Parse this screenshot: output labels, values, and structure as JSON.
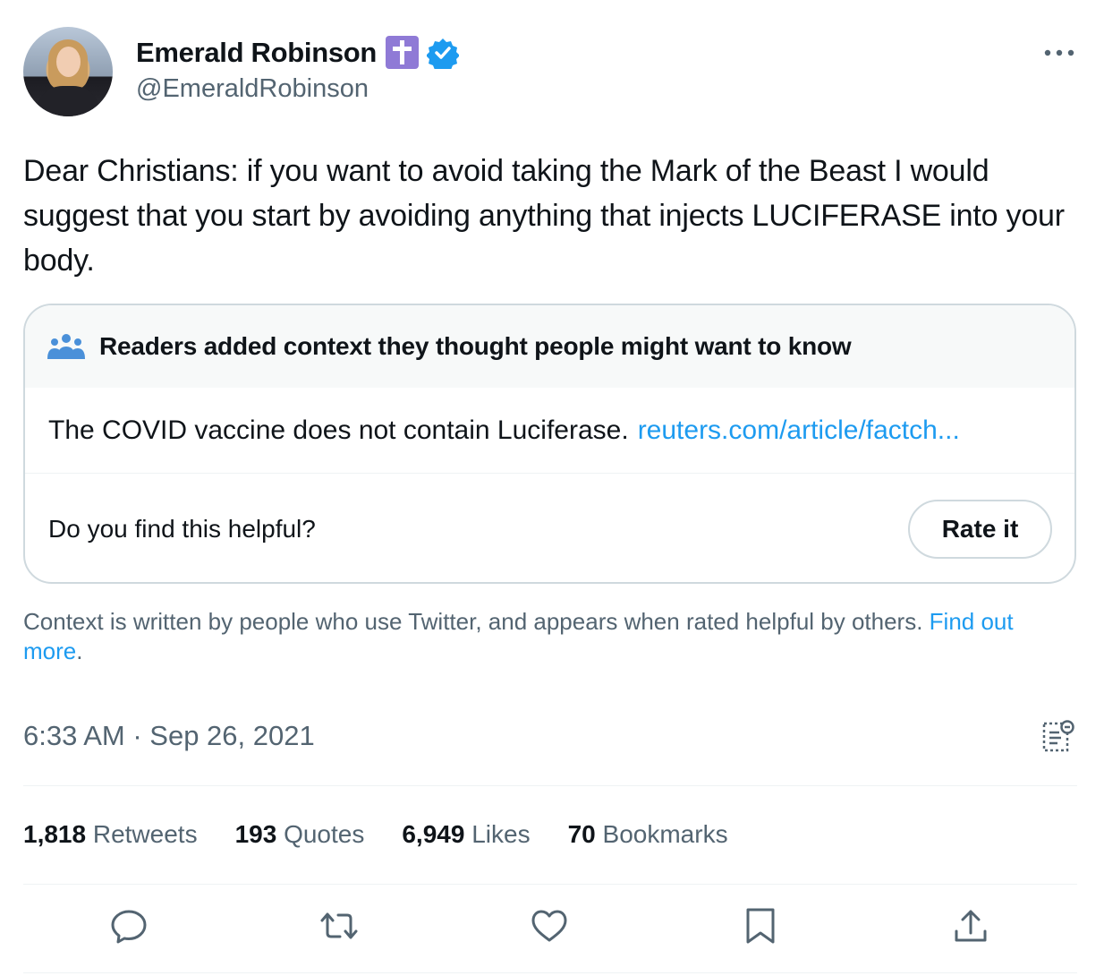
{
  "author": {
    "name": "Emerald Robinson",
    "handle": "@EmeraldRobinson",
    "badge_color": "#8f7ad6",
    "verified_color": "#1d9bf0"
  },
  "tweet": {
    "text": "Dear Christians: if you want to avoid taking the Mark of the Beast I would suggest that you start by avoiding anything that injects LUCIFERASE into your body."
  },
  "note": {
    "heading": "Readers added context they thought people might want to know",
    "body": "The COVID vaccine does not contain Luciferase.",
    "link": "reuters.com/article/factch...",
    "question": "Do you find this helpful?",
    "rate_button": "Rate it"
  },
  "context": {
    "text": "Context is written by people who use Twitter, and appears when rated helpful by others. ",
    "link": "Find out more",
    "period": "."
  },
  "timestamp": "6:33 AM · Sep 26, 2021",
  "stats": [
    {
      "value": "1,818",
      "label": "Retweets"
    },
    {
      "value": "193",
      "label": "Quotes"
    },
    {
      "value": "6,949",
      "label": "Likes"
    },
    {
      "value": "70",
      "label": "Bookmarks"
    }
  ],
  "icons": {
    "more": "more-horizontal-icon",
    "analytics": "view-analytics-icon",
    "reply": "reply-icon",
    "retweet": "retweet-icon",
    "like": "heart-icon",
    "bookmark": "bookmark-icon",
    "share": "share-icon"
  },
  "accent_color": "#1d9bf0"
}
